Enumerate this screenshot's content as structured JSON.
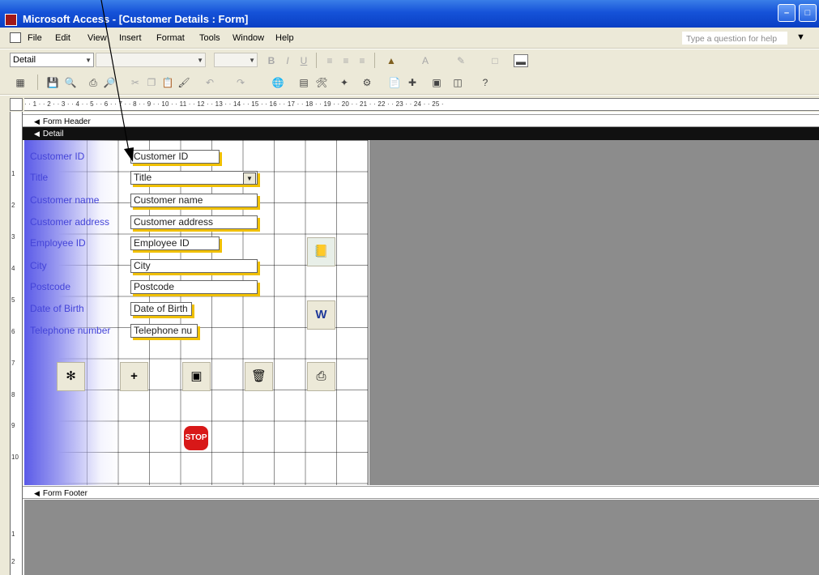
{
  "window": {
    "title": "Microsoft Access - [Customer Details : Form]",
    "controls": [
      "–",
      "□"
    ]
  },
  "menubar": {
    "items": [
      {
        "label": "File"
      },
      {
        "label": "Edit"
      },
      {
        "label": "View"
      },
      {
        "label": "Insert"
      },
      {
        "label": "Format"
      },
      {
        "label": "Tools"
      },
      {
        "label": "Window"
      },
      {
        "label": "Help"
      }
    ],
    "help_placeholder": "Type a question for help"
  },
  "toolbar_format": {
    "object_combo": "Detail",
    "font_combo": "",
    "size_combo": "",
    "bold": "B",
    "italic": "I",
    "underline": "U"
  },
  "ruler": {
    "horizontal": "· · 1 · · 2 · · 3 · · 4 · · 5 · · 6 · · 7 · · 8 · · 9 · · 10 · · 11 · · 12 · · 13 · · 14 · · 15 · · 16 · · 17 · · 18 · · 19 · · 20 · · 21 · · 22 · · 23 · · 24 · · 25 ·",
    "vertical": [
      "1",
      "2",
      "3",
      "4",
      "5",
      "6",
      "7",
      "8",
      "9",
      "10",
      "1",
      "2"
    ]
  },
  "sections": {
    "form_header": "Form Header",
    "detail": "Detail",
    "form_footer": "Form Footer"
  },
  "fields": [
    {
      "label": "Customer ID",
      "value": "Customer ID"
    },
    {
      "label": "Title",
      "value": "Title"
    },
    {
      "label": "Customer name",
      "value": "Customer name"
    },
    {
      "label": "Customer address",
      "value": "Customer address"
    },
    {
      "label": "Employee ID",
      "value": "Employee ID"
    },
    {
      "label": "City",
      "value": "City"
    },
    {
      "label": "Postcode",
      "value": "Postcode"
    },
    {
      "label": "Date of Birth",
      "value": "Date of Birth"
    },
    {
      "label": "Telephone number",
      "value": "Telephone nu"
    }
  ],
  "buttons": {
    "stop_label": "STOP",
    "icons": [
      "binoculars-icon",
      "add-record-icon",
      "save-icon",
      "trash-icon",
      "print-icon",
      "notebook-icon",
      "word-icon"
    ]
  },
  "colors": {
    "titlebar": "#1552d8",
    "label_text": "#4444d8",
    "textbox_shadow": "#f0c000",
    "stop": "#d81818"
  }
}
